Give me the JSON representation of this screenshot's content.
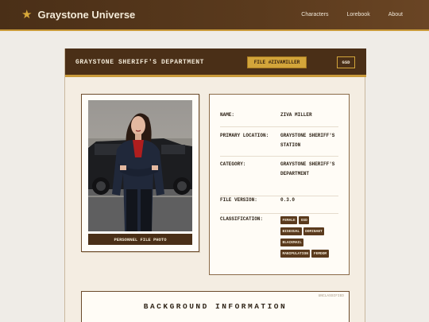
{
  "nav": {
    "brand_icon": "star-icon",
    "brand": "Graystone Universe",
    "links": [
      "Characters",
      "Lorebook",
      "About"
    ]
  },
  "header": {
    "department": "GRAYSTONE SHERIFF'S DEPARTMENT",
    "file_badge": "FILE #ZIVAMILLER",
    "gsd_badge": "GSD"
  },
  "photo": {
    "caption": "PERSONNEL FILE PHOTO"
  },
  "details": {
    "name_label": "NAME:",
    "name_value": "ZIVA MILLER",
    "location_label": "PRIMARY LOCATION:",
    "location_value": "GRAYSTONE SHERIFF'S STATION",
    "category_label": "CATEGORY:",
    "category_value": "GRAYSTONE SHERIFF'S DEPARTMENT",
    "version_label": "FILE VERSION:",
    "version_value": "0.3.0",
    "classification_label": "CLASSIFICATION:",
    "classification_tags": [
      "FEMALE",
      "GSD",
      "BISEXUAL",
      "DOMINANT",
      "BLACKMAIL",
      "MANIPULATION",
      "FEMDOM"
    ]
  },
  "background": {
    "stamp": "UNCLASSIFIED",
    "title": "BACKGROUND INFORMATION"
  },
  "colors": {
    "header_brown": "#4a2f17",
    "accent_gold": "#d3a53a",
    "page_bg": "#efece7"
  }
}
